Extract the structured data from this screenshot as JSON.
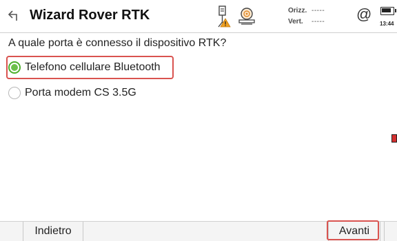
{
  "header": {
    "title": "Wizard Rover RTK",
    "back_icon": "back-arrow-icon",
    "status": {
      "orizz_label": "Orizz.",
      "orizz_value": "-----",
      "vert_label": "Vert.",
      "vert_value": "-----",
      "clock": "13:44"
    }
  },
  "question": "A quale porta è connesso il dispositivo RTK?",
  "options": [
    {
      "label": "Telefono cellulare Bluetooth",
      "selected": true
    },
    {
      "label": "Porta modem CS 3.5G",
      "selected": false
    }
  ],
  "footer": {
    "back_label": "Indietro",
    "next_label": "Avanti"
  },
  "colors": {
    "selected_radio": "#6cc04a",
    "highlight_border": "#d9534f",
    "warning_triangle": "#f0a020"
  }
}
